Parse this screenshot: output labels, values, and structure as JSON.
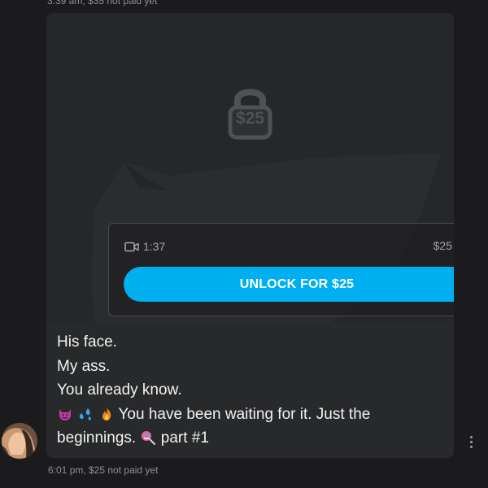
{
  "message_top": {
    "meta": "3:39 am, $35 not paid yet"
  },
  "media": {
    "locked_price": "$25",
    "duration": "1:37",
    "price": "$25",
    "unlock_button": "UNLOCK FOR $25",
    "icons": {
      "big_lock": "padlock-icon",
      "video": "video-camera-icon",
      "small_lock": "padlock-icon"
    }
  },
  "caption": {
    "line1": "His face.",
    "line2": "My ass.",
    "line3": "You already know.",
    "line4_text": "You have been waiting for it. Just the",
    "line5_text": "beginnings.",
    "line5_suffix": "part #1",
    "emojis": [
      "devil-face",
      "sweat-droplets",
      "fire",
      "lollipop"
    ]
  },
  "message_meta": {
    "time_status": "6:01 pm, $25 not paid yet"
  },
  "colors": {
    "accent": "#00aff0",
    "background": "#1b1b1d",
    "bubble": "#28292b"
  }
}
